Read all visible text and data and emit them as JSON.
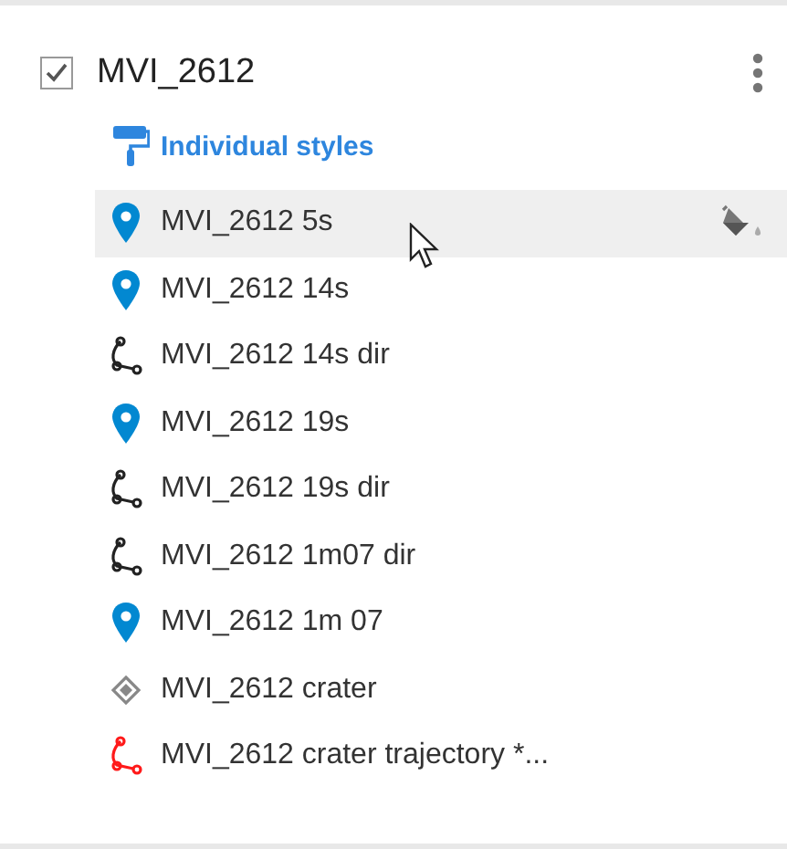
{
  "layer": {
    "title": "MVI_2612",
    "checked": true
  },
  "style_link": "Individual styles",
  "items": [
    {
      "label": "MVI_2612 5s",
      "kind": "pin",
      "color": "#0288d1",
      "selected": true
    },
    {
      "label": "MVI_2612 14s",
      "kind": "pin",
      "color": "#0288d1",
      "selected": false
    },
    {
      "label": "MVI_2612 14s dir",
      "kind": "path",
      "color": "#222222",
      "selected": false
    },
    {
      "label": "MVI_2612 19s",
      "kind": "pin",
      "color": "#0288d1",
      "selected": false
    },
    {
      "label": "MVI_2612 19s dir",
      "kind": "path",
      "color": "#222222",
      "selected": false
    },
    {
      "label": "MVI_2612 1m07 dir",
      "kind": "path",
      "color": "#222222",
      "selected": false
    },
    {
      "label": "MVI_2612 1m 07",
      "kind": "pin",
      "color": "#0288d1",
      "selected": false
    },
    {
      "label": "MVI_2612 crater",
      "kind": "shape",
      "color": "#888888",
      "selected": false
    },
    {
      "label": "MVI_2612 crater trajectory *...",
      "kind": "path",
      "color": "#ff1a1a",
      "selected": false
    }
  ]
}
